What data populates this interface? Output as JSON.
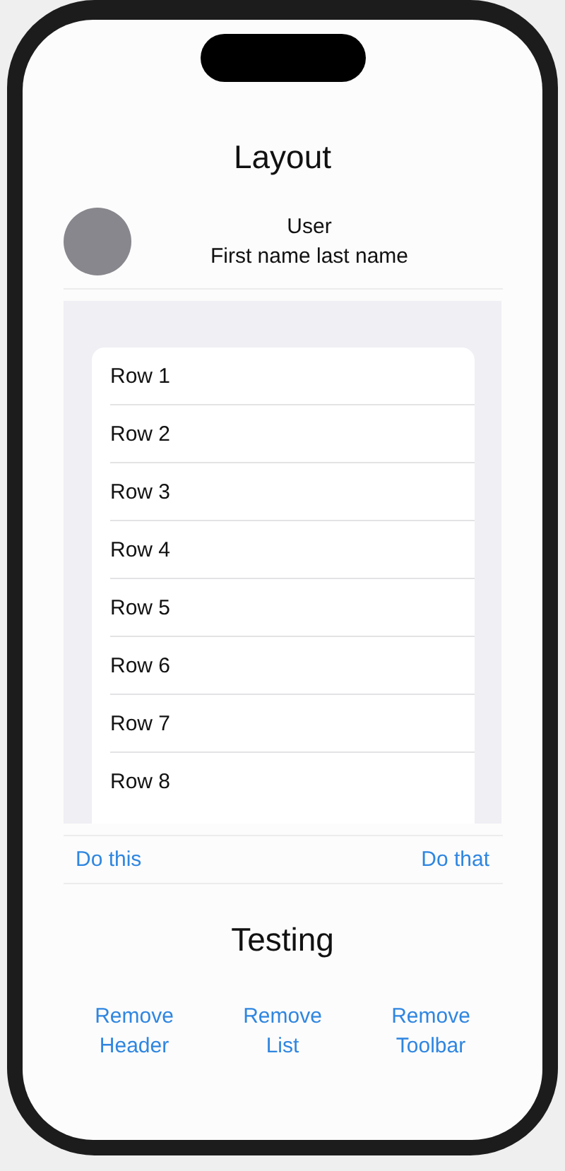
{
  "header": {
    "title": "Layout"
  },
  "user": {
    "name": "User",
    "subtitle": "First name last name"
  },
  "list": {
    "rows": [
      "Row 1",
      "Row 2",
      "Row 3",
      "Row 4",
      "Row 5",
      "Row 6",
      "Row 7",
      "Row 8"
    ]
  },
  "toolbar": {
    "items": [
      "Do this",
      "Do that"
    ]
  },
  "section": {
    "title": "Testing"
  },
  "buttons": [
    "Remove\nHeader",
    "Remove\nList",
    "Remove\nToolbar"
  ]
}
